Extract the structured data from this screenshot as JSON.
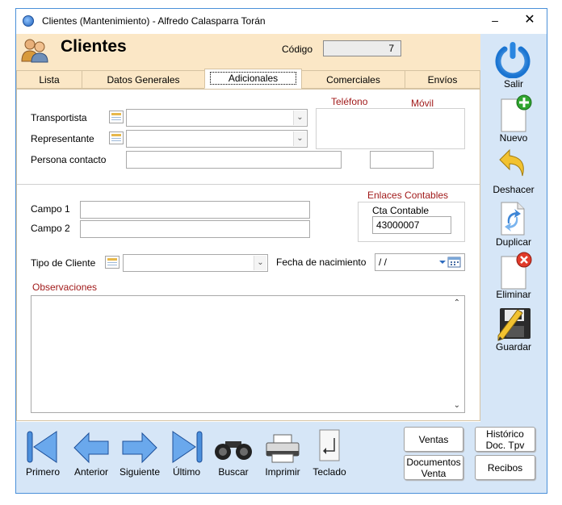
{
  "window": {
    "title": "Clientes (Mantenimiento) - Alfredo Calasparra Torán"
  },
  "header": {
    "title": "Clientes",
    "codigo_label": "Código",
    "codigo_value": "7"
  },
  "tabs": [
    {
      "label": "Lista"
    },
    {
      "label": "Datos Generales"
    },
    {
      "label": "Adicionales"
    },
    {
      "label": "Comerciales"
    },
    {
      "label": "Envíos"
    }
  ],
  "form": {
    "transportista_label": "Transportista",
    "representante_label": "Representante",
    "persona_contacto_label": "Persona contacto",
    "telefono_label": "Teléfono",
    "movil_label": "Móvil",
    "campo1_label": "Campo 1",
    "campo2_label": "Campo 2",
    "enlaces_label": "Enlaces Contables",
    "cta_contable_label": "Cta Contable",
    "cta_contable_value": "43000007",
    "tipo_cliente_label": "Tipo de Cliente",
    "fecha_nacimiento_label": "Fecha de nacimiento",
    "fecha_nacimiento_value": " / /",
    "observaciones_label": "Observaciones"
  },
  "sidebar": {
    "salir": "Salir",
    "nuevo": "Nuevo",
    "deshacer": "Deshacer",
    "duplicar": "Duplicar",
    "eliminar": "Eliminar",
    "guardar": "Guardar"
  },
  "bottom": {
    "primero": "Primero",
    "anterior": "Anterior",
    "siguiente": "Siguiente",
    "ultimo": "Último",
    "buscar": "Buscar",
    "imprimir": "Imprimir",
    "teclado": "Teclado",
    "ventas": "Ventas",
    "documentos_venta_1": "Documentos",
    "documentos_venta_2": "Venta",
    "historico_1": "Histórico",
    "historico_2": "Doc. Tpv",
    "recibos": "Recibos"
  },
  "colors": {
    "header_bg": "#fbe7c6",
    "sidebar_bg": "#d6e6f7",
    "accent_red": "#a11a1a",
    "window_border": "#4a90d9"
  }
}
